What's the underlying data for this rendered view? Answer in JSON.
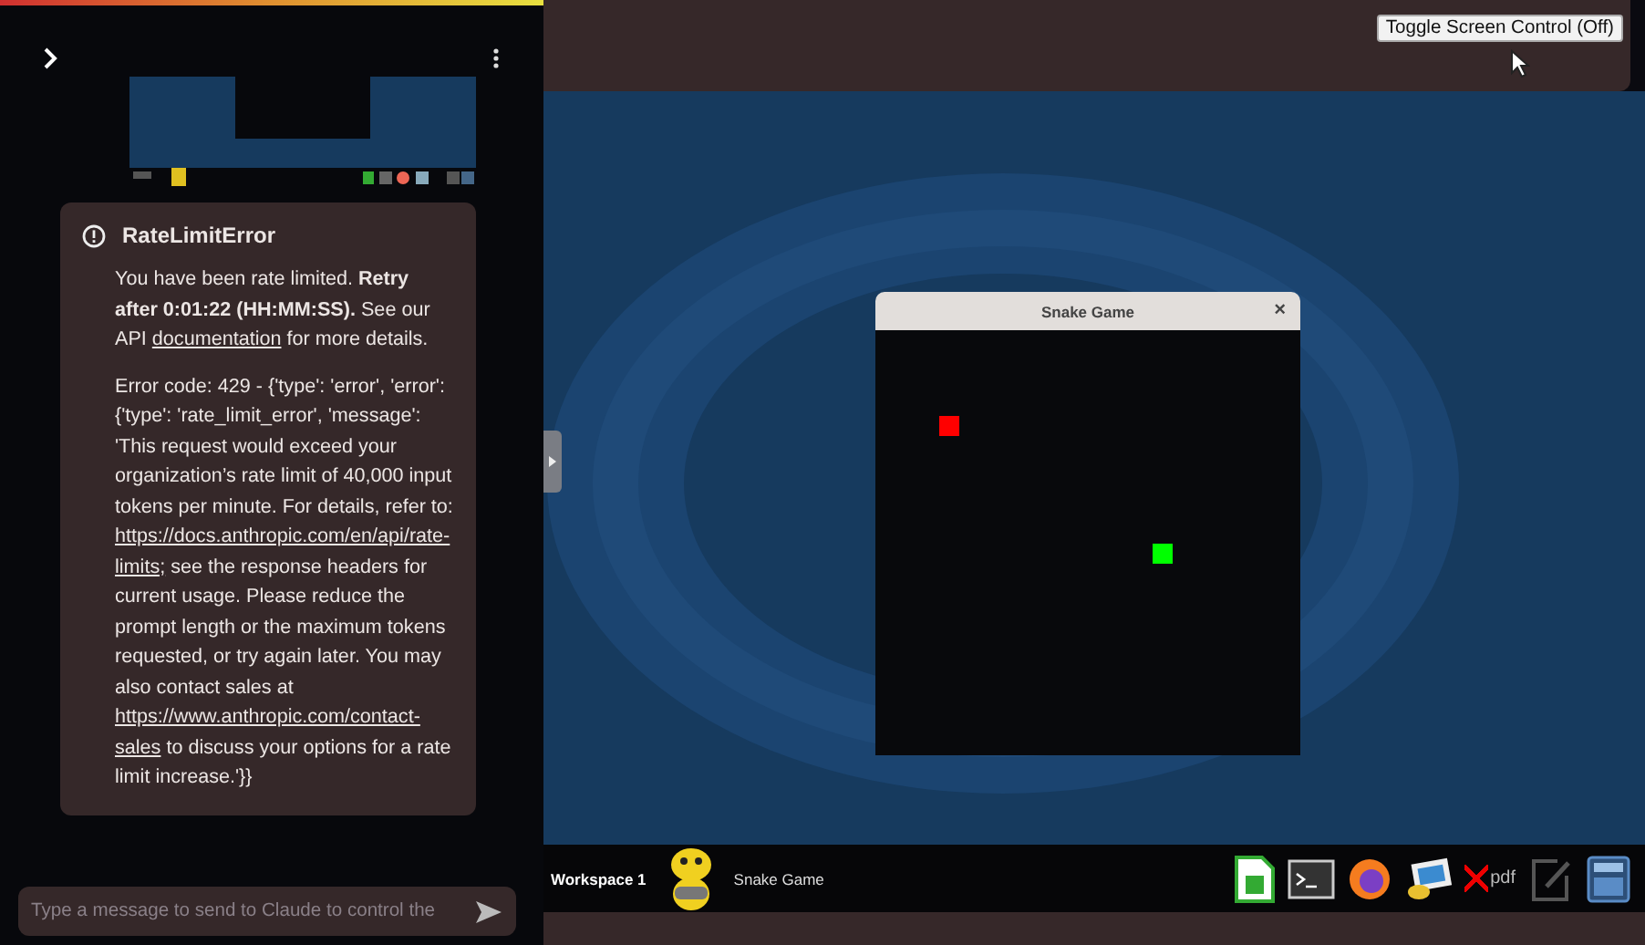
{
  "sidebar": {
    "error": {
      "title": "RateLimitError",
      "paragraphs": [
        [
          {
            "kind": "text",
            "text": "You have been rate limited. "
          },
          {
            "kind": "bold",
            "text": "Retry after 0:01:22 (HH:MM:SS)."
          },
          {
            "kind": "text",
            "text": " See our API "
          },
          {
            "kind": "link",
            "text": "documentation"
          },
          {
            "kind": "text",
            "text": " for more details."
          }
        ],
        [
          {
            "kind": "text",
            "text": "Error code: 429 - {'type': 'error', 'error': {'type': 'rate_limit_error', 'message': 'This request would exceed your organization’s rate limit of 40,000 input tokens per minute. For details, refer to: "
          },
          {
            "kind": "link",
            "text": "https://docs.anthropic.com/en/api/rate-"
          },
          {
            "kind": "link",
            "text": "limits;"
          },
          {
            "kind": "text",
            "text": " see the response headers for current usage. Please reduce the prompt length or the maximum tokens requested, or try again later. You may also contact sales at "
          },
          {
            "kind": "link",
            "text": "https://www.anthropic.com/contact-"
          },
          {
            "kind": "link",
            "text": "sales"
          },
          {
            "kind": "text",
            "text": " to discuss your options for a rate limit increase.'}}"
          }
        ]
      ]
    },
    "message_input": {
      "placeholder": "Type a message to send to Claude to control the"
    }
  },
  "top_bar": {
    "toggle_button": "Toggle Screen Control (Off)"
  },
  "snake_window": {
    "title": "Snake Game",
    "close": "×"
  },
  "taskbar": {
    "workspace": "Workspace 1",
    "window_title": "Snake Game",
    "pdf_label": "pdf"
  }
}
